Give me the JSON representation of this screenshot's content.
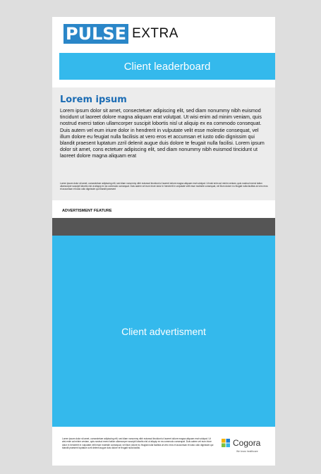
{
  "header": {
    "logo_main": "PULSE",
    "logo_extra": "EXTRA",
    "leaderboard_label": "Client leaderboard"
  },
  "article": {
    "title": "Lorem ipsum",
    "body": "Lorem ipsum dolor sit amet, consectetuer adipiscing elit, sed diam nonummy nibh euismod tincidunt ut laoreet dolore magna aliquam erat volutpat. Ut wisi enim ad minim veniam, quis nostrud exerci tation ullamcorper suscipit lobortis nisl ut aliquip ex ea commodo consequat. Duis autem vel eum iriure dolor in hendrerit in vulputate velit esse molestie consequat, vel illum dolore eu feugiat nulla facilisis at vero eros et accumsan et iusto odio dignissim qui blandit praesent luptatum zzril delenit augue duis dolore te feugait nulla facilisi. Lorem ipsum dolor sit amet, cons ectetuer adipiscing elit, sed diam nonummy nibh euismod tincidunt ut laoreet dolore magna aliquam erat",
    "small_print": "Lorem ipsum dolor sit amet, consectetuer adipiscing elit, sed diam nonummy nibh euismod tincidunt ut laoreet dolore magna aliquam erat volutpat. Ut wisi enim ad minim veniam, quis nostrud exerci tation ullamcorper suscipit lobortis nisl ut aliquip ex ea commodo consequat. Duis autem vel eum iriure dolor in hendrerit in vulputate velit esse molestie consequat, vel illum dolore eu feugiat nulla facilisis at vero eros et accumsan et iusto odio dignissim qui blandit praesent"
  },
  "advert": {
    "feature_label": "ADVERTISMENT FEATURE",
    "main_label": "Client advertisment"
  },
  "footer": {
    "text": "Lorem ipsum dolor sit amet, consectetuer adipiscing elit, sed diam nonummy nibh euismod tincidunt ut laoreet dolore magna aliquam erat volutpat. Ut wisi enim ad minim veniam, quis nostrud exerci tation ullamcorper suscipit lobortis nisl ut aliquip ex ea commodo consequat. Duis autem vel eum iriure dolor in hendrerit in vulputate velit esse molestie consequat, vel illum dolore eu feugiat nulla facilisis at vero eros et accumsan et iusto odio dignissim qui blandit praesent luptatum zzril delenit augue duis dolore te feugait nulla facilisi.",
    "brand_name": "Cogora",
    "brand_tagline": "We know healthcare"
  },
  "colors": {
    "accent_blue": "#34b9ec",
    "logo_blue": "#2a86c8",
    "title_blue": "#1b6cb4",
    "band_grey": "#555555",
    "background": "#dedede"
  }
}
